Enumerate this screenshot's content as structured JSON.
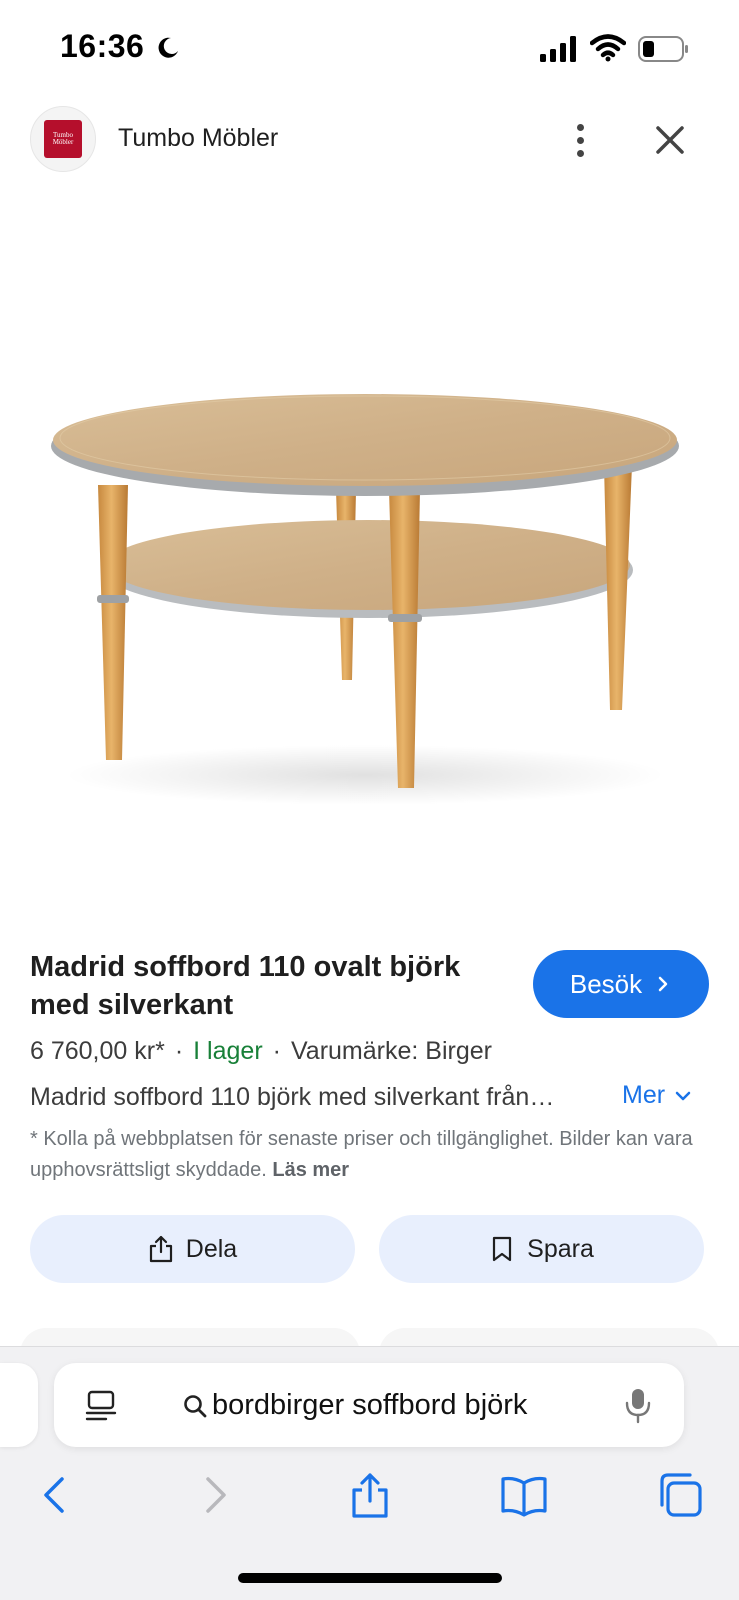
{
  "status_bar": {
    "time": "16:36",
    "icons": [
      "moon-icon",
      "signal-icon",
      "wifi-icon",
      "battery-icon"
    ]
  },
  "header": {
    "site_name": "Tumbo Möbler",
    "logo_text": "Tumbo Möbler"
  },
  "product": {
    "title": "Madrid soffbord 110 ovalt björk med silverkant",
    "visit_label": "Besök",
    "price": "6 760,00 kr*",
    "stock": "I lager",
    "brand": "Varumärke: Birger",
    "description": "Madrid soffbord 110 björk med silverkant från…",
    "more_label": "Mer",
    "disclaimer": "* Kolla på webbplatsen för senaste priser och tillgänglighet. Bilder kan vara upphovsrättsligt skyddade.",
    "read_more": "Läs mer"
  },
  "actions": {
    "share_label": "Dela",
    "save_label": "Spara"
  },
  "safari": {
    "address": "bordbirger soffbord björk"
  },
  "colors": {
    "accent": "#1a73e8",
    "stock": "#188038",
    "action_bg": "#e8effd",
    "logo": "#b50f2c"
  }
}
